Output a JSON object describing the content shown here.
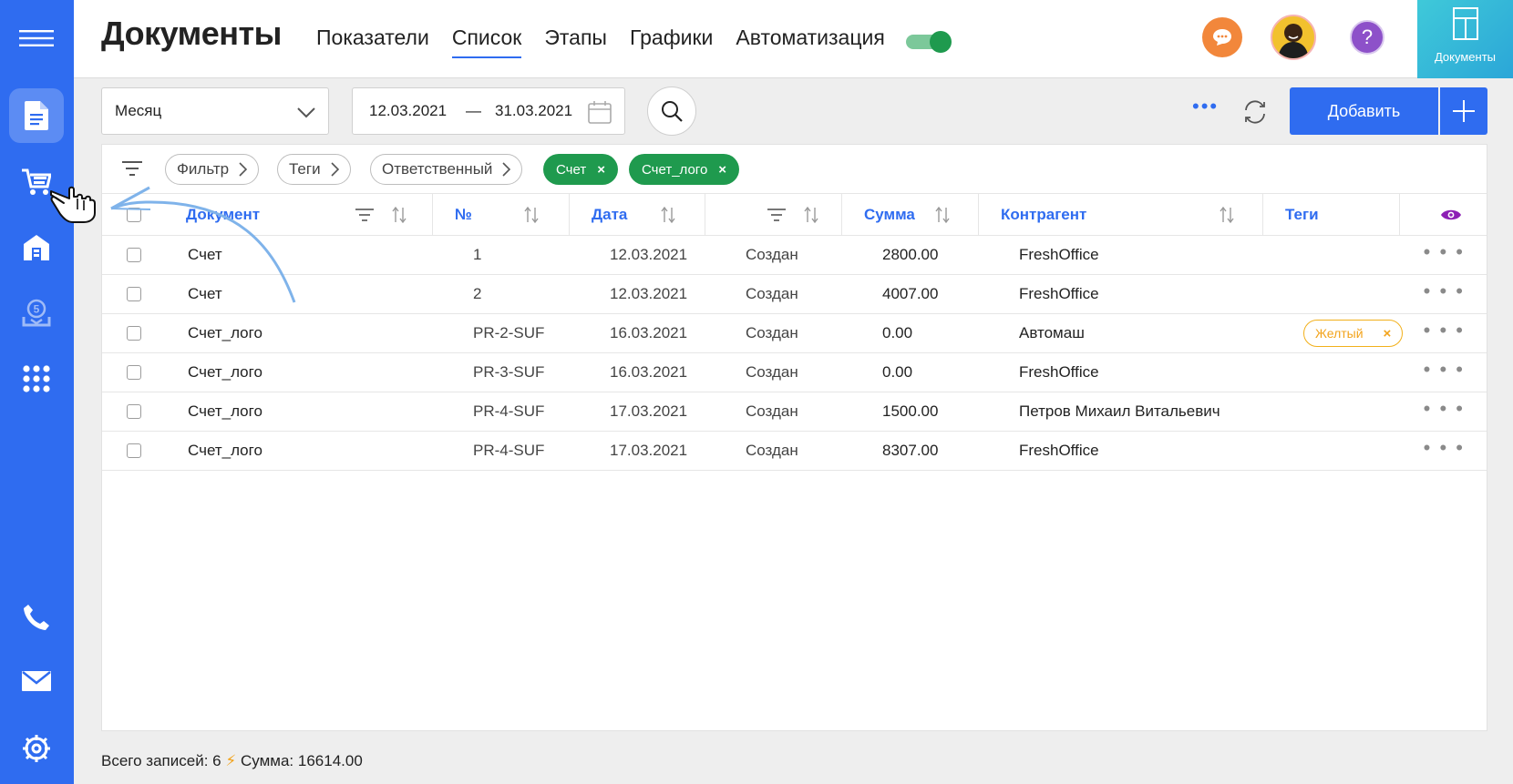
{
  "header": {
    "title": "Документы",
    "tabs": [
      {
        "label": "Показатели",
        "active": false
      },
      {
        "label": "Список",
        "active": true
      },
      {
        "label": "Этапы",
        "active": false
      },
      {
        "label": "Графики",
        "active": false
      },
      {
        "label": "Автоматизация",
        "active": false
      }
    ],
    "toggle_on": true,
    "help_label": "?",
    "doc_tile_label": "Документы"
  },
  "sidebar": {
    "items": [
      {
        "icon": "menu-icon"
      },
      {
        "icon": "document-icon",
        "active": true
      },
      {
        "icon": "cart-icon"
      },
      {
        "icon": "warehouse-icon"
      },
      {
        "icon": "download-icon",
        "badge": "5"
      },
      {
        "icon": "apps-grid-icon"
      },
      {
        "icon": "phone-icon"
      },
      {
        "icon": "mail-icon"
      },
      {
        "icon": "settings-gear-icon"
      }
    ]
  },
  "toolbar": {
    "period_value": "Месяц",
    "date_from": "12.03.2021",
    "date_sep": "—",
    "date_to": "31.03.2021",
    "add_label": "Добавить"
  },
  "filters": {
    "chips": [
      "Фильтр",
      "Теги",
      "Ответственный"
    ],
    "active_tags": [
      "Счет",
      "Счет_лого"
    ],
    "tag_close": "×"
  },
  "table": {
    "columns": {
      "document": "Документ",
      "number": "№",
      "date": "Дата",
      "status": "",
      "sum": "Сумма",
      "contractor": "Контрагент",
      "tags": "Теги"
    },
    "rows": [
      {
        "document": "Счет",
        "number": "1",
        "date": "12.03.2021",
        "status": "Создан",
        "sum": "2800.00",
        "contractor": "FreshOffice",
        "tag": ""
      },
      {
        "document": "Счет",
        "number": "2",
        "date": "12.03.2021",
        "status": "Создан",
        "sum": "4007.00",
        "contractor": "FreshOffice",
        "tag": ""
      },
      {
        "document": "Счет_лого",
        "number": "PR-2-SUF",
        "date": "16.03.2021",
        "status": "Создан",
        "sum": "0.00",
        "contractor": "Автомаш",
        "tag": "Желтый"
      },
      {
        "document": "Счет_лого",
        "number": "PR-3-SUF",
        "date": "16.03.2021",
        "status": "Создан",
        "sum": "0.00",
        "contractor": "FreshOffice",
        "tag": ""
      },
      {
        "document": "Счет_лого",
        "number": "PR-4-SUF",
        "date": "17.03.2021",
        "status": "Создан",
        "sum": "1500.00",
        "contractor": "Петров Михаил Витальевич",
        "tag": ""
      },
      {
        "document": "Счет_лого",
        "number": "PR-4-SUF",
        "date": "17.03.2021",
        "status": "Создан",
        "sum": "8307.00",
        "contractor": "FreshOffice",
        "tag": ""
      }
    ],
    "row_menu": "• • •",
    "tag_close": "×"
  },
  "footer": {
    "records": "Всего записей: 6",
    "bolt": "⚡",
    "sum": "Сумма: 16614.00"
  },
  "colors": {
    "accent": "#2f6cf0",
    "green": "#1f9a4e",
    "orange": "#f2873b",
    "purple": "#8d51c9",
    "yellow": "#f2a31b"
  }
}
